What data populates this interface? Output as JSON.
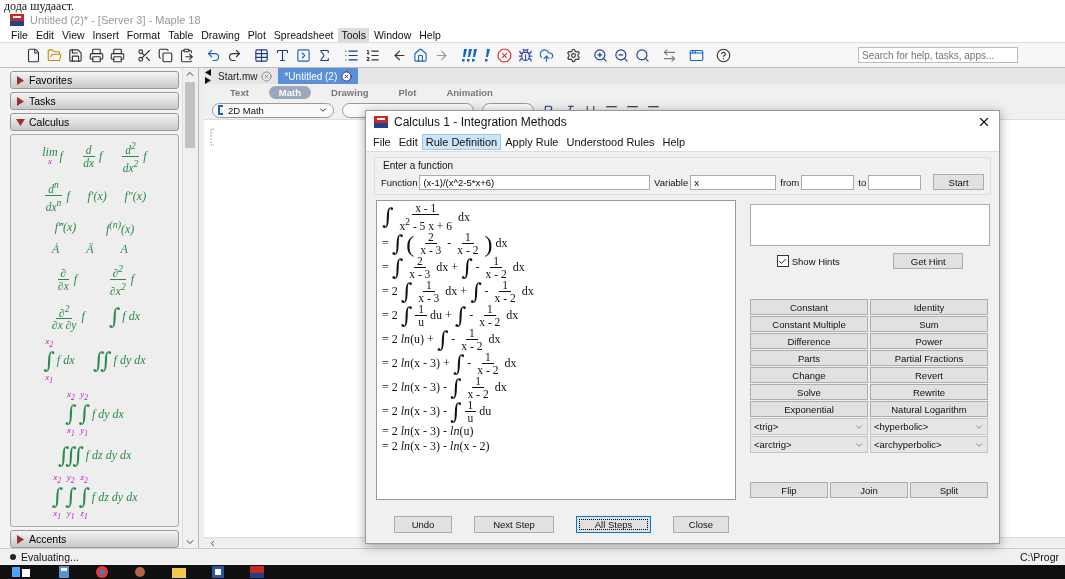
{
  "page_caption": "дода шудааст.",
  "window": {
    "title": "Untitled (2)* - [Server 3] - Maple 18"
  },
  "menu": [
    {
      "label": "File",
      "selected": false
    },
    {
      "label": "Edit",
      "selected": false
    },
    {
      "label": "View",
      "selected": false
    },
    {
      "label": "Insert",
      "selected": false
    },
    {
      "label": "Format",
      "selected": false
    },
    {
      "label": "Table",
      "selected": false
    },
    {
      "label": "Drawing",
      "selected": false
    },
    {
      "label": "Plot",
      "selected": false
    },
    {
      "label": "Spreadsheet",
      "selected": false
    },
    {
      "label": "Tools",
      "selected": true
    },
    {
      "label": "Window",
      "selected": false
    },
    {
      "label": "Help",
      "selected": false
    }
  ],
  "search": {
    "placeholder": "Search for help, tasks, apps..."
  },
  "palettes": [
    {
      "title": "Favorites",
      "expanded": false
    },
    {
      "title": "Tasks",
      "expanded": false
    },
    {
      "title": "Calculus",
      "expanded": true,
      "rows": [
        [
          [
            {
              "kind": "under",
              "text": "lim",
              "below": "x"
            },
            {
              "kind": "text",
              "text": "f"
            }
          ],
          [
            {
              "kind": "frac",
              "num": "d",
              "den": "dx"
            },
            {
              "kind": "text",
              "text": "f"
            }
          ],
          [
            {
              "kind": "frac",
              "num": "d$^{2}$",
              "den": "dx$^{2}$"
            },
            {
              "kind": "text",
              "text": "f"
            }
          ]
        ],
        [
          [
            {
              "kind": "frac",
              "num": "d$^{n}$",
              "den": "dx$^{n}$"
            },
            {
              "kind": "text",
              "text": "f"
            }
          ],
          [
            {
              "kind": "text",
              "text": "f′(x)"
            }
          ],
          [
            {
              "kind": "text",
              "text": "f″(x)"
            }
          ]
        ],
        [
          [
            {
              "kind": "text",
              "text": "f‴(x)"
            }
          ],
          [
            {
              "kind": "text",
              "text": "f$^{(n)}$(x)"
            }
          ]
        ],
        [
          [
            {
              "kind": "text",
              "text": "Ȧ"
            }
          ],
          [
            {
              "kind": "text",
              "text": "Ä"
            }
          ],
          [
            {
              "kind": "text",
              "text": "A⃛"
            }
          ]
        ],
        [
          [
            {
              "kind": "frac",
              "num": "∂",
              "den": "∂x"
            },
            {
              "kind": "text",
              "text": "f"
            }
          ],
          [
            {
              "kind": "frac",
              "num": "∂$^{2}$",
              "den": "∂x$^{2}$"
            },
            {
              "kind": "text",
              "text": "f"
            }
          ]
        ],
        [
          [
            {
              "kind": "frac",
              "num": "∂$^{2}$",
              "den": "∂x ∂y"
            },
            {
              "kind": "text",
              "text": "f"
            }
          ],
          [
            {
              "kind": "int",
              "text": "∫"
            },
            {
              "kind": "text",
              "text": "f dx"
            }
          ]
        ],
        [
          [
            {
              "kind": "limint",
              "text": "∫",
              "upper": "x$_{2}$",
              "lower": "x$_{1}$"
            },
            {
              "kind": "text",
              "text": "f dx"
            }
          ],
          [
            {
              "kind": "int",
              "text": "∬"
            },
            {
              "kind": "text",
              "text": "f dy dx"
            }
          ]
        ],
        [
          [
            {
              "kind": "limint",
              "text": "∫",
              "upper": "x$_{2}$",
              "lower": "x$_{1}$"
            },
            {
              "kind": "limint",
              "text": "∫",
              "upper": "y$_{2}$",
              "lower": "y$_{1}$"
            },
            {
              "kind": "text",
              "text": "f dy dx"
            }
          ]
        ],
        [
          [
            {
              "kind": "int",
              "text": "∭"
            },
            {
              "kind": "text",
              "text": "f dz dy dx"
            }
          ]
        ],
        [
          [
            {
              "kind": "limint",
              "text": "∫",
              "upper": "x$_{2}$",
              "lower": "x$_{1}$"
            },
            {
              "kind": "limint",
              "text": "∫",
              "upper": "y$_{2}$",
              "lower": "y$_{1}$"
            },
            {
              "kind": "limint",
              "text": "∫",
              "upper": "z$_{2}$",
              "lower": "z$_{1}$"
            },
            {
              "kind": "text",
              "text": "f dz dy dx"
            }
          ]
        ]
      ]
    },
    {
      "title": "Accents",
      "expanded": false
    }
  ],
  "tabs": [
    {
      "label": "Start.mw",
      "selected": false
    },
    {
      "label": "*Untitled (2)",
      "selected": true
    }
  ],
  "modes": [
    {
      "label": "Text",
      "selected": false
    },
    {
      "label": "Math",
      "selected": true
    },
    {
      "label": "Drawing",
      "selected": false
    },
    {
      "label": "Plot",
      "selected": false
    },
    {
      "label": "Animation",
      "selected": false
    }
  ],
  "format_bar": {
    "input_mode": "2D Math"
  },
  "dialog": {
    "title": "Calculus 1 - Integration Methods",
    "menu": [
      {
        "label": "File",
        "selected": false
      },
      {
        "label": "Edit",
        "selected": false
      },
      {
        "label": "Rule Definition",
        "selected": true
      },
      {
        "label": "Apply Rule",
        "selected": false
      },
      {
        "label": "Understood Rules",
        "selected": false
      },
      {
        "label": "Help",
        "selected": false
      }
    ],
    "group_title": "Enter a function",
    "fields": [
      {
        "label": "Function",
        "value": "(x-1)/(x^2-5*x+6)"
      },
      {
        "label": "Variable",
        "value": "x"
      },
      {
        "label": "from"
      },
      {
        "label": "to"
      }
    ],
    "start_button": "Start",
    "steps": [
      [
        {
          "kind": "int",
          "text": "∫"
        },
        {
          "kind": "frac",
          "num": "x - 1",
          "den": "x$^{2}$ - 5 x + 6"
        },
        {
          "kind": "text",
          "text": "dx"
        }
      ],
      [
        {
          "kind": "text",
          "text": "="
        },
        {
          "kind": "int",
          "text": "∫"
        },
        {
          "kind": "paren",
          "text": "("
        },
        {
          "kind": "frac",
          "num": "2",
          "den": "x - 3"
        },
        {
          "kind": "text",
          "text": "-"
        },
        {
          "kind": "frac",
          "num": "1",
          "den": "x - 2"
        },
        {
          "kind": "paren",
          "text": ")"
        },
        {
          "kind": "text",
          "text": "dx"
        }
      ],
      [
        {
          "kind": "text",
          "text": "="
        },
        {
          "kind": "int",
          "text": "∫"
        },
        {
          "kind": "frac",
          "num": "2",
          "den": "x - 3"
        },
        {
          "kind": "text",
          "text": "dx +"
        },
        {
          "kind": "int",
          "text": "∫"
        },
        {
          "kind": "text",
          "text": "-"
        },
        {
          "kind": "frac",
          "num": "1",
          "den": "x - 2"
        },
        {
          "kind": "text",
          "text": "dx"
        }
      ],
      [
        {
          "kind": "text",
          "text": "= 2"
        },
        {
          "kind": "int",
          "text": "∫"
        },
        {
          "kind": "frac",
          "num": "1",
          "den": "x - 3"
        },
        {
          "kind": "text",
          "text": "dx +"
        },
        {
          "kind": "int",
          "text": "∫"
        },
        {
          "kind": "text",
          "text": "-"
        },
        {
          "kind": "frac",
          "num": "1",
          "den": "x - 2"
        },
        {
          "kind": "text",
          "text": "dx"
        }
      ],
      [
        {
          "kind": "text",
          "text": "= 2"
        },
        {
          "kind": "int",
          "text": "∫"
        },
        {
          "kind": "frac",
          "num": "1",
          "den": "u"
        },
        {
          "kind": "text",
          "text": "du +"
        },
        {
          "kind": "int",
          "text": "∫"
        },
        {
          "kind": "text",
          "text": "-"
        },
        {
          "kind": "frac",
          "num": "1",
          "den": "x - 2"
        },
        {
          "kind": "text",
          "text": "dx"
        }
      ],
      [
        {
          "kind": "text",
          "text": "= 2 *ln*(u) +"
        },
        {
          "kind": "int",
          "text": "∫"
        },
        {
          "kind": "text",
          "text": "-"
        },
        {
          "kind": "frac",
          "num": "1",
          "den": "x - 2"
        },
        {
          "kind": "text",
          "text": "dx"
        }
      ],
      [
        {
          "kind": "text",
          "text": "= 2 *ln*(x - 3) +"
        },
        {
          "kind": "int",
          "text": "∫"
        },
        {
          "kind": "text",
          "text": "-"
        },
        {
          "kind": "frac",
          "num": "1",
          "den": "x - 2"
        },
        {
          "kind": "text",
          "text": "dx"
        }
      ],
      [
        {
          "kind": "text",
          "text": "= 2 *ln*(x - 3) -"
        },
        {
          "kind": "int",
          "text": "∫"
        },
        {
          "kind": "frac",
          "num": "1",
          "den": "x - 2"
        },
        {
          "kind": "text",
          "text": "dx"
        }
      ],
      [
        {
          "kind": "text",
          "text": "= 2 *ln*(x - 3) -"
        },
        {
          "kind": "int",
          "text": "∫"
        },
        {
          "kind": "frac",
          "num": "1",
          "den": "u"
        },
        {
          "kind": "text",
          "text": "du"
        }
      ],
      [
        {
          "kind": "text",
          "text": "= 2 *ln*(x - 3) - *ln*(u)"
        }
      ],
      [
        {
          "kind": "text",
          "text": "= 2 *ln*(x - 3) - *ln*(x - 2)"
        }
      ]
    ],
    "show_hints": {
      "label": "Show Hints",
      "checked": true
    },
    "hint_button": "Get Hint",
    "rules": [
      "Constant",
      "Identity",
      "Constant Multiple",
      "Sum",
      "Difference",
      "Power",
      "Parts",
      "Partial Fractions",
      "Change",
      "Revert",
      "Solve",
      "Rewrite",
      "Exponential",
      "Natural Logarithm"
    ],
    "selects": [
      "<trig>",
      "<hyperbolic>",
      "<arctrig>",
      "<archyperbolic>"
    ],
    "edit_buttons": [
      "Flip",
      "Join",
      "Split"
    ],
    "footer_buttons": [
      {
        "label": "Undo",
        "selected": false
      },
      {
        "label": "Next Step",
        "selected": false
      },
      {
        "label": "All Steps",
        "selected": true
      },
      {
        "label": "Close",
        "selected": false
      }
    ]
  },
  "status_bar": {
    "message": "Evaluating...",
    "path": "C:\\Progr"
  }
}
